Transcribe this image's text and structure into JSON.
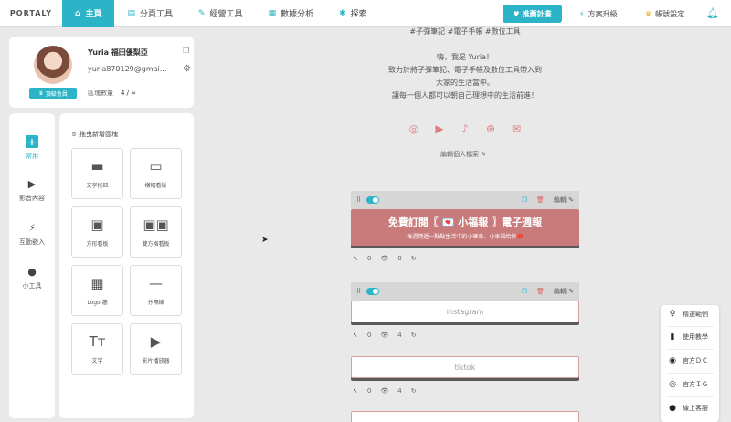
{
  "app": {
    "logo_text": "PORTALY"
  },
  "nav": [
    {
      "icon": "⌂",
      "label": "主頁",
      "active": true
    },
    {
      "icon": "▤",
      "label": "分頁工具"
    },
    {
      "icon": "✎",
      "label": "經營工具"
    },
    {
      "icon": "▦",
      "label": "數據分析"
    },
    {
      "icon": "✱",
      "label": "探索"
    }
  ],
  "promo": {
    "icon": "♥",
    "label": "推薦計畫"
  },
  "upgrade": {
    "icon": "⚡",
    "label": "方案升級"
  },
  "account": {
    "icon": "♛",
    "label": "帳號設定"
  },
  "profile": {
    "name": "Yuria 福田優梨亞",
    "email": "yuria870129@gmai...",
    "vip_label": "頂級會員",
    "blocks_label": "區塊數量",
    "blocks_value": "4 / ∞"
  },
  "categories": [
    {
      "icon": "+",
      "label": "常用",
      "active": true
    },
    {
      "icon": "▶",
      "label": "影音內容"
    },
    {
      "icon": "⚡",
      "label": "互動嵌入"
    },
    {
      "icon": "●",
      "label": "小工具"
    }
  ],
  "palette": {
    "hint": "拖曳新增區塊",
    "tiles": [
      {
        "icon": "▬",
        "label": "文字按鈕"
      },
      {
        "icon": "▭",
        "label": "橫幅看板"
      },
      {
        "icon": "▣",
        "label": "方形看板"
      },
      {
        "icon": "▣▣",
        "label": "雙方格看板"
      },
      {
        "icon": "▦",
        "label": "Logo 牆"
      },
      {
        "icon": "—",
        "label": "分隔線"
      },
      {
        "icon": "Tт",
        "label": "文字"
      },
      {
        "icon": "▶",
        "label": "影片播放器"
      }
    ]
  },
  "preview": {
    "bio_lines": [
      "#子彈筆記 #電子手帳 #數位工具",
      "",
      "嗨，我是 Yuria！",
      "致力於將子彈筆記、電子手帳及數位工具帶入到",
      "大家的生活當中。",
      "讓每一個人都可以朝自己理想中的生活前進！"
    ],
    "social_icons": [
      "◎",
      "▶",
      "♪",
      "⊕",
      "✉"
    ],
    "edit_profile": "編輯個人檔案 ✎",
    "edit_label": "編輯",
    "banner": {
      "title": "免費訂閱〖 💌 小福報 〗電子週報",
      "subtitle": "每週傳遞一點點生活中的小確幸、小幸福給你❤️"
    },
    "block1_stats": {
      "clicks": "0",
      "views": "0"
    },
    "instagram": {
      "label": "instagram",
      "clicks": "0",
      "views": "4"
    },
    "tiktok": {
      "label": "tiktok",
      "clicks": "0",
      "views": "4"
    }
  },
  "float_menu": [
    {
      "icon": "♀",
      "label": "精選範例"
    },
    {
      "icon": "▮",
      "label": "使用教學"
    },
    {
      "icon": "◉",
      "label": "官方ＤＣ"
    },
    {
      "icon": "◎",
      "label": "官方ＩＧ"
    },
    {
      "icon": "●",
      "label": "線上客服"
    }
  ],
  "colors": {
    "accent": "#2bb3c7",
    "banner": "#c97b7b"
  }
}
